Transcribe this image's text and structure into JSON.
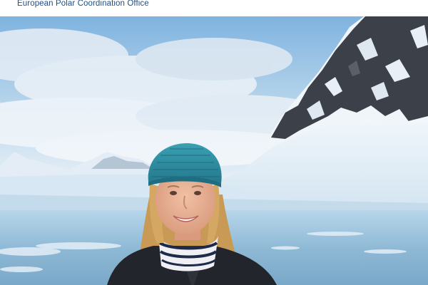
{
  "header": {
    "organization": "European Polar Coordination Office"
  },
  "photo": {
    "subject": "person-in-polar-landscape",
    "colors": {
      "sky": "#8fbfe4",
      "cloud": "#e7eef6",
      "snow": "#e9f2fa",
      "water": "#a9cde3",
      "rock": "#3c4048",
      "hat": "#2f8ca0",
      "hair": "#cfa35c",
      "jacket": "#23262c",
      "skin": "#e9b294"
    }
  }
}
